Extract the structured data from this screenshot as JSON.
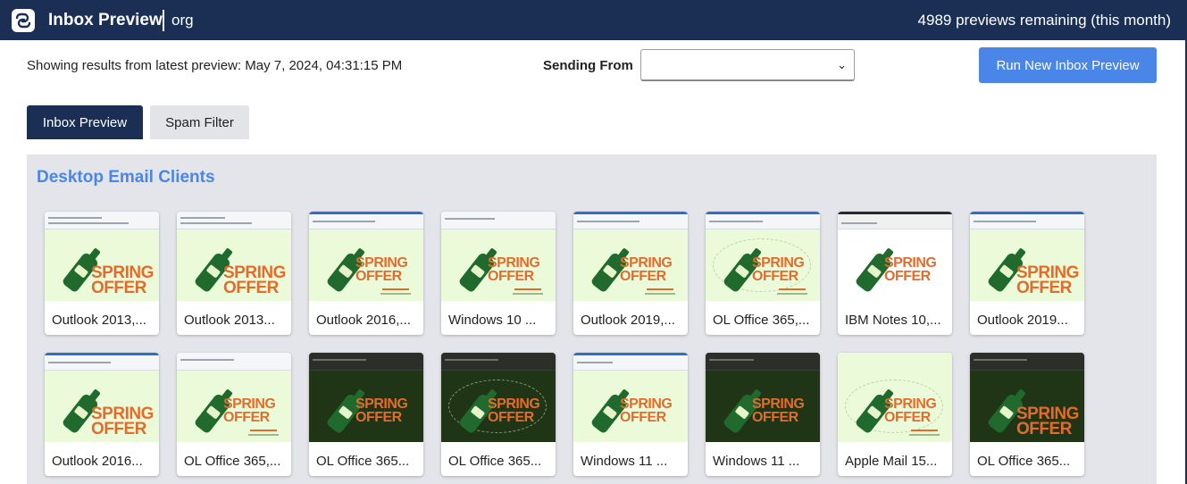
{
  "header": {
    "app_title": "Inbox Preview",
    "org": "org",
    "remaining": "4989 previews remaining (this month)"
  },
  "toolbar": {
    "showing": "Showing results from latest preview: May 7, 2024, 04:31:15 PM",
    "sending_from_label": "Sending From",
    "sending_from_value": "",
    "run_button": "Run New Inbox Preview"
  },
  "tabs": [
    {
      "label": "Inbox Preview",
      "active": true
    },
    {
      "label": "Spam Filter",
      "active": false
    }
  ],
  "section": {
    "title": "Desktop Email Clients"
  },
  "thumbnail_text": {
    "spring": "SPRING",
    "offer": "OFFER"
  },
  "clients_row1": [
    {
      "label": "Outlook 2013,..."
    },
    {
      "label": "Outlook 2013..."
    },
    {
      "label": "Outlook 2016,..."
    },
    {
      "label": "Windows 10 ..."
    },
    {
      "label": "Outlook 2019,..."
    },
    {
      "label": "OL Office 365,..."
    },
    {
      "label": "IBM Notes 10,..."
    },
    {
      "label": "Outlook 2019..."
    }
  ],
  "clients_row2": [
    {
      "label": "Outlook 2016..."
    },
    {
      "label": "OL Office 365,..."
    },
    {
      "label": "OL Office 365..."
    },
    {
      "label": "OL Office 365..."
    },
    {
      "label": "Windows 11 ..."
    },
    {
      "label": "Windows 11 ..."
    },
    {
      "label": "Apple Mail 15..."
    },
    {
      "label": "OL Office 365..."
    }
  ],
  "colors": {
    "header_bg": "#1b2f55",
    "accent": "#4a86e8",
    "offer_orange": "#e56b2a",
    "panel_bg": "#e4e5ea"
  }
}
